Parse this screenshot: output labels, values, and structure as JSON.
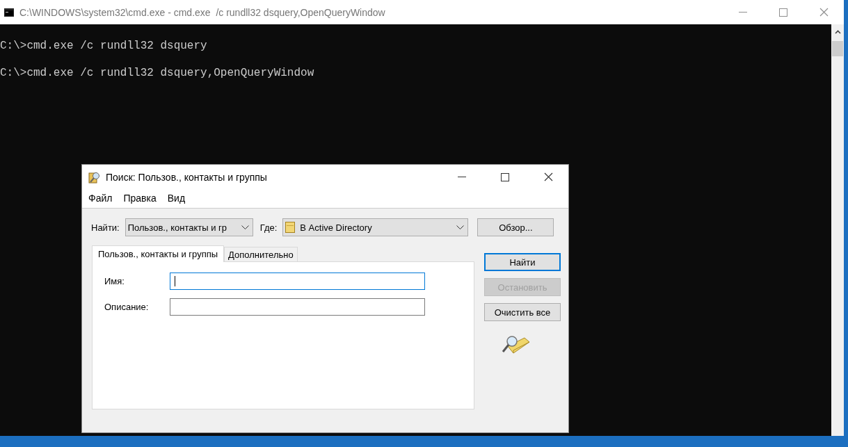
{
  "console_window": {
    "title": "C:\\WINDOWS\\system32\\cmd.exe - cmd.exe  /c rundll32 dsquery,OpenQueryWindow",
    "lines": [
      "C:\\>cmd.exe /c rundll32 dsquery",
      "C:\\>cmd.exe /c rundll32 dsquery,OpenQueryWindow"
    ]
  },
  "dialog": {
    "title": "Поиск: Пользов., контакты и группы",
    "menu": [
      "Файл",
      "Правка",
      "Вид"
    ],
    "find_label": "Найти:",
    "find_value": "Пользов., контакты и гр",
    "where_label": "Где:",
    "where_value": "В Active Directory",
    "browse_button": "Обзор...",
    "tabs": [
      {
        "label": "Пользов., контакты и группы",
        "selected": true
      },
      {
        "label": "Дополнительно",
        "selected": false
      }
    ],
    "fields": [
      {
        "label": "Имя:",
        "focused": true
      },
      {
        "label": "Описание:",
        "focused": false
      }
    ],
    "buttons": [
      {
        "label": "Найти",
        "disabled": false,
        "default": true
      },
      {
        "label": "Остановить",
        "disabled": true,
        "default": false
      },
      {
        "label": "Очистить все",
        "disabled": false,
        "default": false
      }
    ]
  }
}
